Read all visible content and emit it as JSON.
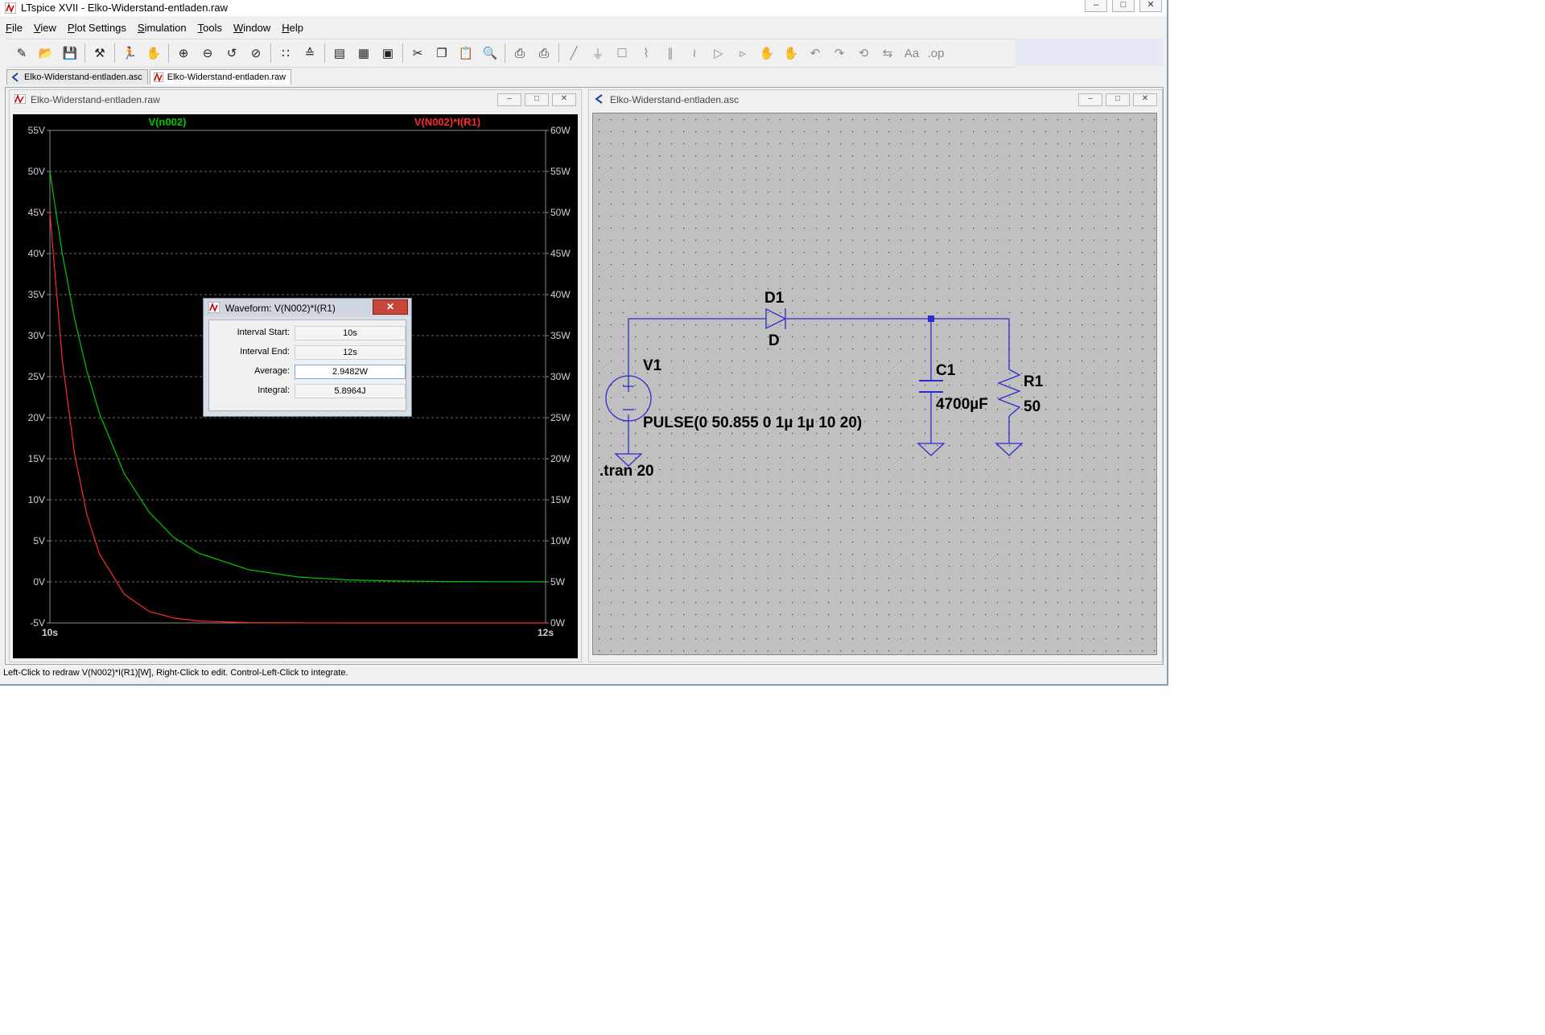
{
  "app": {
    "title": "LTspice XVII - Elko-Widerstand-entladen.raw",
    "window_buttons": [
      "–",
      "□",
      "✕"
    ]
  },
  "menu": [
    {
      "label": "File",
      "underline": "F",
      "rest": "ile"
    },
    {
      "label": "View",
      "underline": "V",
      "rest": "iew"
    },
    {
      "label": "Plot Settings",
      "underline": "P",
      "rest": "lot Settings"
    },
    {
      "label": "Simulation",
      "underline": "S",
      "rest": "imulation"
    },
    {
      "label": "Tools",
      "underline": "T",
      "rest": "ools"
    },
    {
      "label": "Window",
      "underline": "W",
      "rest": "indow"
    },
    {
      "label": "Help",
      "underline": "H",
      "rest": "elp"
    }
  ],
  "toolbar_icons": [
    "new-schematic-icon",
    "open-icon",
    "save-icon",
    "control-panel-icon",
    "run-icon",
    "halt-icon",
    "zoom-in-icon",
    "zoom-out-icon",
    "zoom-back-icon",
    "zoom-fit-icon",
    "autorange-icon",
    "manual-limits-icon",
    "pane-add-icon",
    "tile-icon",
    "cascade-icon",
    "cut-icon",
    "copy-icon",
    "paste-icon",
    "find-icon",
    "print-setup-icon",
    "print-icon",
    "wire-icon",
    "ground-icon",
    "label-icon",
    "resistor-icon",
    "capacitor-icon",
    "inductor-icon",
    "diode-icon",
    "component-icon",
    "move-icon",
    "drag-icon",
    "undo-icon",
    "redo-icon",
    "rotate-icon",
    "mirror-icon",
    "text-icon",
    "spice-directive-icon"
  ],
  "tabs": [
    {
      "label": "Elko-Widerstand-entladen.asc",
      "active": false
    },
    {
      "label": "Elko-Widerstand-entladen.raw",
      "active": true
    }
  ],
  "waveform_window": {
    "title": "Elko-Widerstand-entladen.raw",
    "buttons": [
      "–",
      "□",
      "✕"
    ]
  },
  "schematic_window": {
    "title": "Elko-Widerstand-entladen.asc",
    "buttons": [
      "–",
      "□",
      "✕"
    ]
  },
  "chart_data": {
    "type": "line",
    "x_ticks": [
      "10s",
      "12s"
    ],
    "x_range": [
      10,
      12
    ],
    "left_axis": {
      "range": [
        -5,
        55
      ],
      "ticks": [
        "55V",
        "50V",
        "45V",
        "40V",
        "35V",
        "30V",
        "25V",
        "20V",
        "15V",
        "10V",
        "5V",
        "0V",
        "-5V"
      ]
    },
    "right_axis": {
      "range": [
        0,
        60
      ],
      "ticks": [
        "60W",
        "55W",
        "50W",
        "45W",
        "40W",
        "35W",
        "30W",
        "25W",
        "20W",
        "15W",
        "10W",
        "5W",
        "0W"
      ]
    },
    "grid": true,
    "series": [
      {
        "name": "V(n002)",
        "color": "#00c800",
        "axis": "left",
        "x": [
          10,
          10.05,
          10.1,
          10.15,
          10.2,
          10.3,
          10.4,
          10.5,
          10.6,
          10.8,
          11.0,
          11.2,
          11.4,
          11.6,
          11.8,
          12.0
        ],
        "y": [
          50.0,
          40.0,
          32.0,
          25.6,
          20.5,
          13.2,
          8.5,
          5.4,
          3.5,
          1.5,
          0.6,
          0.25,
          0.1,
          0.04,
          0.02,
          0.01
        ]
      },
      {
        "name": "V(N002)*I(R1)",
        "color": "#ff2a2a",
        "axis": "right",
        "x": [
          10,
          10.05,
          10.1,
          10.15,
          10.2,
          10.3,
          10.4,
          10.5,
          10.6,
          10.8,
          11.0,
          11.2,
          11.4,
          11.6,
          11.8,
          12.0
        ],
        "y": [
          50.0,
          32.0,
          20.5,
          13.1,
          8.4,
          3.5,
          1.4,
          0.6,
          0.24,
          0.04,
          0.01,
          0.0,
          0.0,
          0.0,
          0.0,
          0.0
        ]
      }
    ]
  },
  "dialog": {
    "title": "Waveform: V(N002)*I(R1)",
    "close": "✕",
    "rows": [
      {
        "label": "Interval Start:",
        "value": "10s"
      },
      {
        "label": "Interval End:",
        "value": "12s"
      },
      {
        "label": "Average:",
        "value": "2.9482W"
      },
      {
        "label": "Integral:",
        "value": "5.8964J"
      }
    ]
  },
  "schematic": {
    "d1_name": "D1",
    "d1_value": "D",
    "v1_name": "V1",
    "v1_value": "PULSE(0 50.855 0 1µ 1µ 10 20)",
    "c1_name": "C1",
    "c1_value": "4700µF",
    "r1_name": "R1",
    "r1_value": "50",
    "directive": ".tran 20",
    "wire_color": "#2b2bd0"
  },
  "status": "Left-Click to redraw V(N002)*I(R1)[W],  Right-Click to edit. Control-Left-Click to integrate."
}
